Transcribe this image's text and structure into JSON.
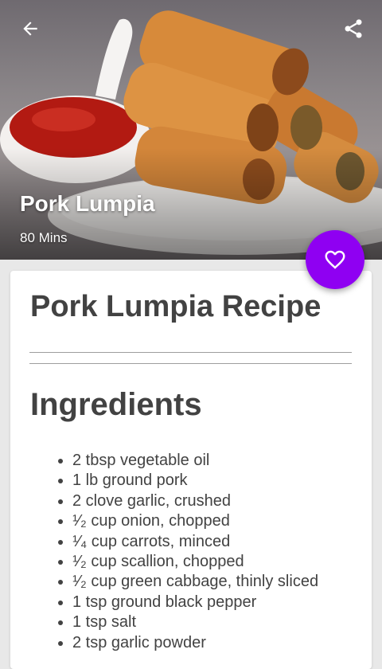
{
  "header": {
    "back_icon": "arrow-left-icon",
    "share_icon": "share-icon",
    "title": "Pork Lumpia",
    "time": "80 Mins"
  },
  "favorite": {
    "icon": "heart-outline-icon",
    "color": "#8f00f2"
  },
  "card": {
    "title": "Pork Lumpia Recipe",
    "ingredients_heading": "Ingredients",
    "ingredients": [
      "2 tbsp vegetable oil",
      "1 lb ground pork",
      "2 clove garlic, crushed",
      "¹⁄₂ cup onion, chopped",
      "¹⁄₄ cup carrots, minced",
      "¹⁄₂ cup scallion, chopped",
      "¹⁄₂ cup green cabbage, thinly sliced",
      "1 tsp ground black pepper",
      "1 tsp salt",
      "2 tsp garlic powder"
    ]
  }
}
